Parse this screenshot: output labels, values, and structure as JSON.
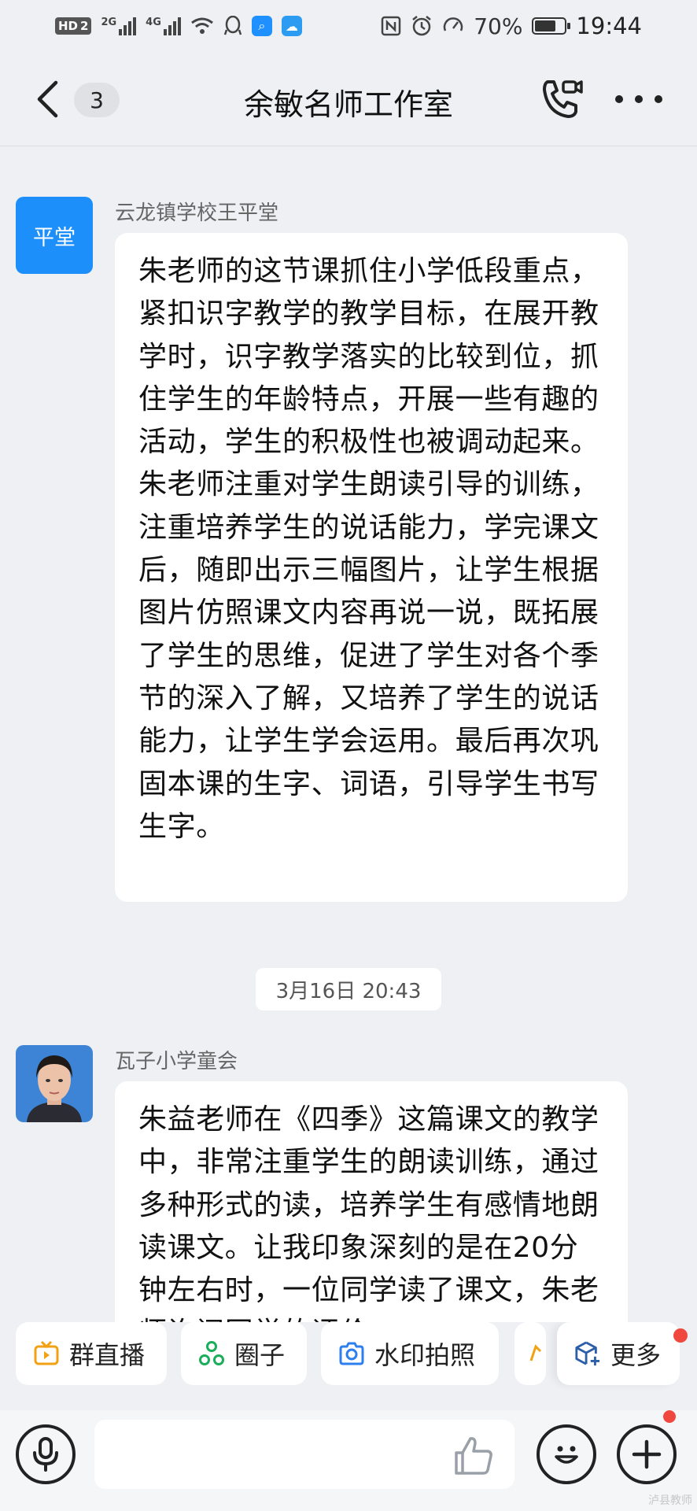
{
  "status_bar": {
    "hd_label": "HD",
    "sim_label": "2",
    "sig1_label": "2G",
    "sig2_label": "4G",
    "battery_percent": "70%",
    "battery_level": 0.7,
    "time": "19:44"
  },
  "header": {
    "unread_count": "3",
    "title": "余敏名师工作室"
  },
  "messages": [
    {
      "avatar_text": "平堂",
      "sender": "云龙镇学校王平堂",
      "text": "朱老师的这节课抓住小学低段重点，紧扣识字教学的教学目标，在展开教学时，识字教学落实的比较到位，抓住学生的年龄特点，开展一些有趣的活动，学生的积极性也被调动起来。朱老师注重对学生朗读引导的训练，注重培养学生的说话能力，学完课文后，随即出示三幅图片，让学生根据图片仿照课文内容再说一说，既拓展了学生的思维，促进了学生对各个季节的深入了解，又培养了学生的说话能力，让学生学会运用。最后再次巩固本课的生字、词语，引导学生书写生字。"
    },
    {
      "sender": "瓦子小学童会",
      "text": "朱益老师在《四季》这篇课文的教学中，非常注重学生的朗读训练，通过多种形式的读，培养学生有感情地朗读课文。让我印象深刻的是在20分钟左右时，一位同学读了课文，朱老师询问同学的评价"
    }
  ],
  "timestamp": "3月16日 20:43",
  "quick_actions": [
    {
      "label": "群直播",
      "icon": "tv-icon"
    },
    {
      "label": "圈子",
      "icon": "circle-icon"
    },
    {
      "label": "水印拍照",
      "icon": "camera-icon"
    },
    {
      "label": "",
      "icon": "partial-icon"
    },
    {
      "label": "更多",
      "icon": "cube-plus-icon"
    }
  ],
  "input": {
    "value": ""
  },
  "watermark": "泸县教师"
}
